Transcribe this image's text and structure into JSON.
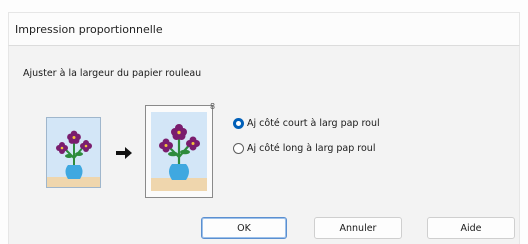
{
  "dialog": {
    "title": "Impression proportionnelle",
    "instruction": "Ajuster à la largeur du papier rouleau"
  },
  "preview": {
    "source_icon": "flower-vase-paper-icon",
    "arrow_icon": "right-arrow-icon",
    "result_icon": "flower-vase-roll-paper-icon",
    "corner_mark": "8"
  },
  "options": [
    {
      "label": "Aj côté court à larg pap roul",
      "selected": true
    },
    {
      "label": "Aj côté long à larg pap roul",
      "selected": false
    }
  ],
  "buttons": {
    "ok": "OK",
    "cancel": "Annuler",
    "help": "Aide"
  },
  "colors": {
    "accent": "#005fb8",
    "sky": "#d3e6f7",
    "flower": "#7a1d6e",
    "vase": "#3fa8e0",
    "leaves": "#2e8b3c",
    "sand": "#efd6ad"
  }
}
